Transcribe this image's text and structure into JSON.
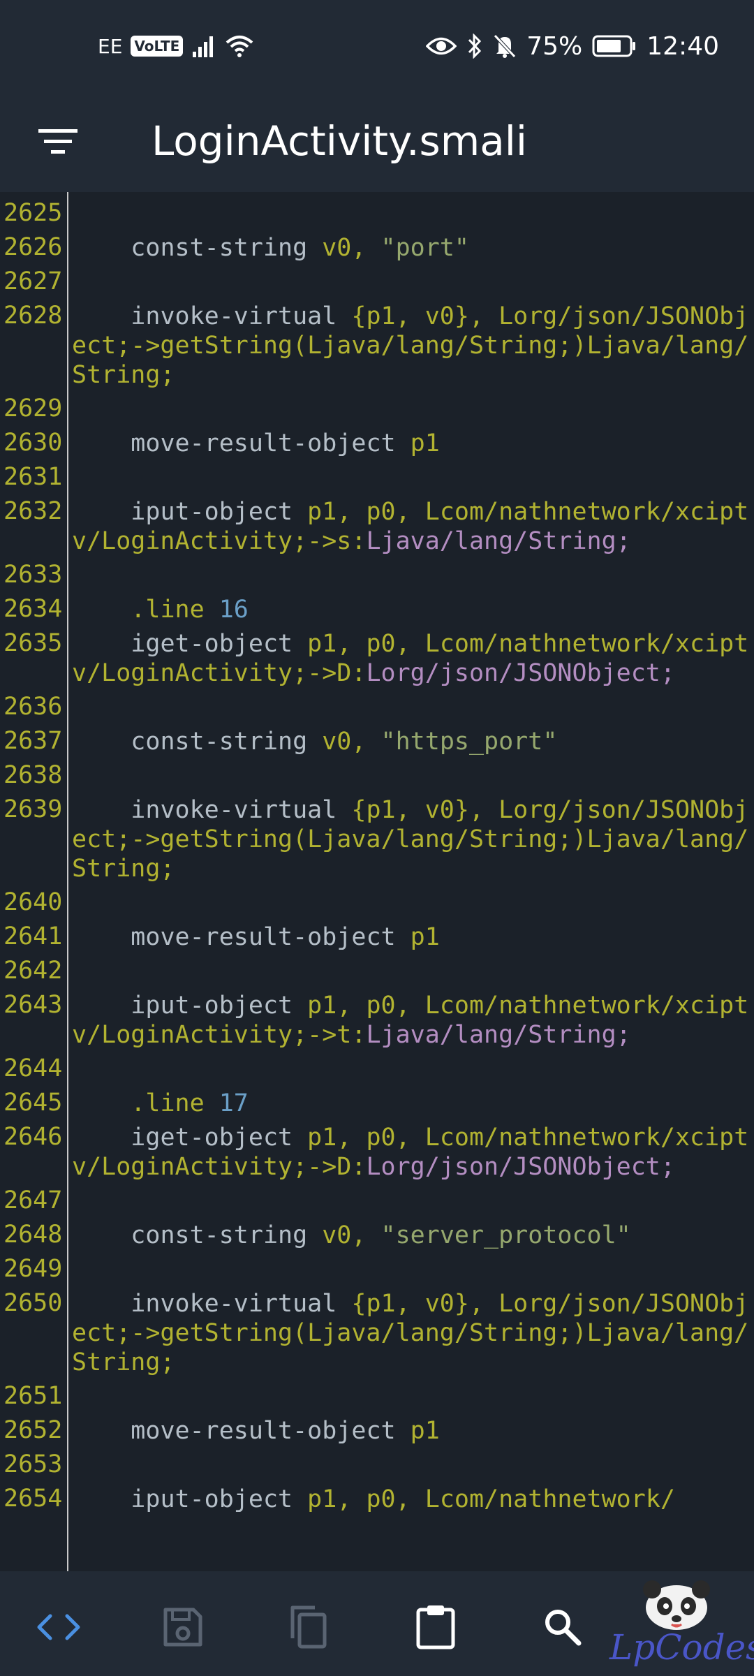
{
  "status_bar": {
    "carrier": "EE",
    "volte": "VoLTE",
    "battery_percent": "75%",
    "time": "12:40",
    "icons": [
      "signal-icon",
      "wifi-icon",
      "eye-icon",
      "bluetooth-icon",
      "bell-muted-icon",
      "battery-icon"
    ]
  },
  "app_bar": {
    "menu_icon": "filter-menu-icon",
    "title": "LoginActivity.smali"
  },
  "editor": {
    "lines": [
      {
        "num": "2625",
        "segments": []
      },
      {
        "num": "2626",
        "segments": [
          {
            "text": "    const-string ",
            "cls": "t-kw"
          },
          {
            "text": "v0, ",
            "cls": "t-plain"
          },
          {
            "text": "\"port\"",
            "cls": "t-str"
          }
        ]
      },
      {
        "num": "2627",
        "segments": []
      },
      {
        "num": "2628",
        "segments": [
          {
            "text": "    invoke-virtual ",
            "cls": "t-kw"
          },
          {
            "text": "{p1, v0}, Lorg/json/JSONObject;->getString(Ljava/lang/String;)Ljava/lang/String;",
            "cls": "t-plain"
          }
        ]
      },
      {
        "num": "2629",
        "segments": []
      },
      {
        "num": "2630",
        "segments": [
          {
            "text": "    move-result-object ",
            "cls": "t-kw"
          },
          {
            "text": "p1",
            "cls": "t-plain"
          }
        ]
      },
      {
        "num": "2631",
        "segments": []
      },
      {
        "num": "2632",
        "segments": [
          {
            "text": "    iput-object ",
            "cls": "t-kw"
          },
          {
            "text": "p1, p0, Lcom/nathnetwork/xciptv/LoginActivity;->s:",
            "cls": "t-plain"
          },
          {
            "text": "Ljava/lang/String;",
            "cls": "t-type"
          }
        ]
      },
      {
        "num": "2633",
        "segments": []
      },
      {
        "num": "2634",
        "segments": [
          {
            "text": "    .line ",
            "cls": "t-plain"
          },
          {
            "text": "16",
            "cls": "t-num"
          }
        ]
      },
      {
        "num": "2635",
        "segments": [
          {
            "text": "    iget-object ",
            "cls": "t-kw"
          },
          {
            "text": "p1, p0, Lcom/nathnetwork/xciptv/LoginActivity;->D:",
            "cls": "t-plain"
          },
          {
            "text": "Lorg/json/JSONObject;",
            "cls": "t-type"
          }
        ]
      },
      {
        "num": "2636",
        "segments": []
      },
      {
        "num": "2637",
        "segments": [
          {
            "text": "    const-string ",
            "cls": "t-kw"
          },
          {
            "text": "v0, ",
            "cls": "t-plain"
          },
          {
            "text": "\"https_port\"",
            "cls": "t-str"
          }
        ]
      },
      {
        "num": "2638",
        "segments": []
      },
      {
        "num": "2639",
        "segments": [
          {
            "text": "    invoke-virtual ",
            "cls": "t-kw"
          },
          {
            "text": "{p1, v0}, Lorg/json/JSONObject;->getString(Ljava/lang/String;)Ljava/lang/String;",
            "cls": "t-plain"
          }
        ]
      },
      {
        "num": "2640",
        "segments": []
      },
      {
        "num": "2641",
        "segments": [
          {
            "text": "    move-result-object ",
            "cls": "t-kw"
          },
          {
            "text": "p1",
            "cls": "t-plain"
          }
        ]
      },
      {
        "num": "2642",
        "segments": []
      },
      {
        "num": "2643",
        "segments": [
          {
            "text": "    iput-object ",
            "cls": "t-kw"
          },
          {
            "text": "p1, p0, Lcom/nathnetwork/xciptv/LoginActivity;->t:",
            "cls": "t-plain"
          },
          {
            "text": "Ljava/lang/String;",
            "cls": "t-type"
          }
        ]
      },
      {
        "num": "2644",
        "segments": []
      },
      {
        "num": "2645",
        "segments": [
          {
            "text": "    .line ",
            "cls": "t-plain"
          },
          {
            "text": "17",
            "cls": "t-num"
          }
        ]
      },
      {
        "num": "2646",
        "segments": [
          {
            "text": "    iget-object ",
            "cls": "t-kw"
          },
          {
            "text": "p1, p0, Lcom/nathnetwork/xciptv/LoginActivity;->D:",
            "cls": "t-plain"
          },
          {
            "text": "Lorg/json/JSONObject;",
            "cls": "t-type"
          }
        ]
      },
      {
        "num": "2647",
        "segments": []
      },
      {
        "num": "2648",
        "segments": [
          {
            "text": "    const-string ",
            "cls": "t-kw"
          },
          {
            "text": "v0, ",
            "cls": "t-plain"
          },
          {
            "text": "\"server_protocol\"",
            "cls": "t-str"
          }
        ]
      },
      {
        "num": "2649",
        "segments": []
      },
      {
        "num": "2650",
        "segments": [
          {
            "text": "    invoke-virtual ",
            "cls": "t-kw"
          },
          {
            "text": "{p1, v0}, Lorg/json/JSONObject;->getString(Ljava/lang/String;)Ljava/lang/String;",
            "cls": "t-plain"
          }
        ]
      },
      {
        "num": "2651",
        "segments": []
      },
      {
        "num": "2652",
        "segments": [
          {
            "text": "    move-result-object ",
            "cls": "t-kw"
          },
          {
            "text": "p1",
            "cls": "t-plain"
          }
        ]
      },
      {
        "num": "2653",
        "segments": []
      },
      {
        "num": "2654",
        "segments": [
          {
            "text": "    iput-object ",
            "cls": "t-kw"
          },
          {
            "text": "p1, p0, Lcom/nathnetwork/",
            "cls": "t-plain"
          }
        ]
      }
    ]
  },
  "toolbar": {
    "buttons": [
      {
        "name": "code-view-button",
        "icon": "code-icon"
      },
      {
        "name": "save-button",
        "icon": "save-icon"
      },
      {
        "name": "copy-button",
        "icon": "copy-icon"
      },
      {
        "name": "paste-button",
        "icon": "clipboard-icon"
      },
      {
        "name": "search-button",
        "icon": "search-icon"
      }
    ],
    "watermark": "LpCodes"
  },
  "colors": {
    "background": "#1b2129",
    "bars": "#222a35",
    "line_number": "#b2b331",
    "keyword": "#b5bfc8",
    "string": "#96a86e",
    "number": "#6ba0c8",
    "type": "#b48ec2",
    "accent": "#4a90e2"
  }
}
